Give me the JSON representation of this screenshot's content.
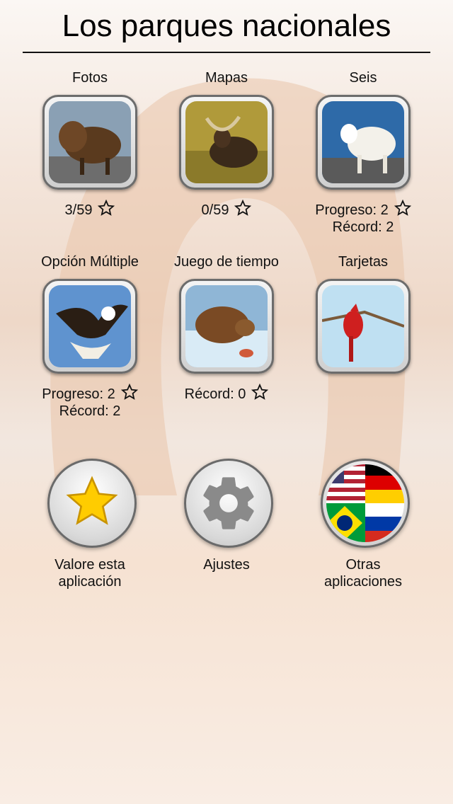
{
  "header": {
    "title": "Los parques nacionales"
  },
  "modes": [
    {
      "label": "Fotos",
      "image": "bison-photo",
      "stat1": "3/59",
      "stat2": ""
    },
    {
      "label": "Mapas",
      "image": "moose-photo",
      "stat1": "0/59",
      "stat2": ""
    },
    {
      "label": "Seis",
      "image": "mountain-goat-photo",
      "stat1": "Progreso: 2",
      "stat2": "Récord: 2"
    },
    {
      "label": "Opción Múltiple",
      "image": "bald-eagle-photo",
      "stat1": "Progreso: 2",
      "stat2": "Récord: 2"
    },
    {
      "label": "Juego de tiempo",
      "image": "grizzly-bear-photo",
      "stat1": "Récord: 0",
      "stat2": ""
    },
    {
      "label": "Tarjetas",
      "image": "cardinal-bird-photo",
      "stat1": "",
      "stat2": ""
    }
  ],
  "actions": {
    "rate": {
      "line1": "Valore esta",
      "line2": "aplicación",
      "icon": "star-icon"
    },
    "settings": {
      "line1": "Ajustes",
      "line2": "",
      "icon": "gear-icon"
    },
    "other": {
      "line1": "Otras",
      "line2": "aplicaciones",
      "icon": "flags-icon"
    }
  },
  "colors": {
    "star_fill": "#ffcc00",
    "gear": "#8a8a8a",
    "tile_border": "#6c6c6c"
  }
}
